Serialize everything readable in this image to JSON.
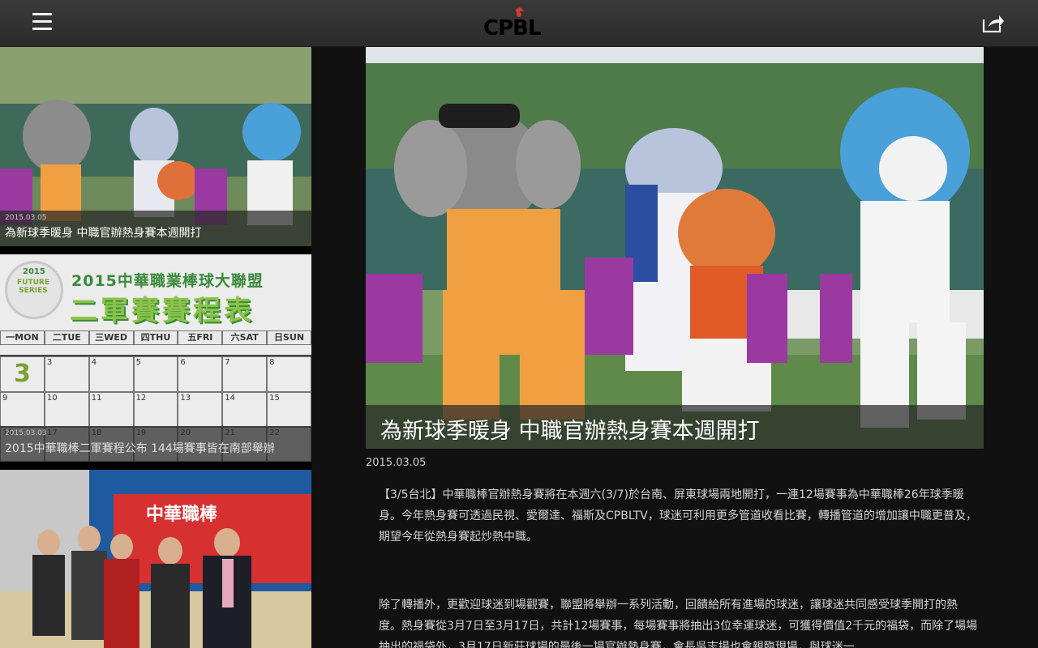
{
  "header": {
    "logo_text": "CPBL",
    "menu_icon": "hamburger-menu-icon",
    "share_icon": "share-icon"
  },
  "news_list": [
    {
      "date": "2015.03.05",
      "title": "為新球季暖身 中職官辦熱身賽本週開打"
    },
    {
      "date": "2015.03.03",
      "title": "2015中華職棒二軍賽程公布 144場賽事皆在南部舉辦",
      "schedule_image": {
        "year": "2015",
        "badge": "FUTURE SERIES",
        "heading_line1": "2015中華職業棒球大聯盟",
        "heading_line2": "二軍賽賽程表",
        "days": [
          "一MON",
          "二TUE",
          "三WED",
          "四THU",
          "五FRI",
          "六SAT",
          "日SUN"
        ],
        "dates": [
          "3",
          "3",
          "4",
          "5",
          "6",
          "7",
          "8",
          "9",
          "10",
          "11",
          "12",
          "13",
          "14",
          "15",
          "16",
          "17",
          "18",
          "19",
          "20",
          "21",
          "22"
        ]
      }
    },
    {
      "date": "",
      "title": "",
      "banner_text": "中華職棒"
    }
  ],
  "article": {
    "title": "為新球季暖身 中職官辦熱身賽本週開打",
    "date": "2015.03.05",
    "paragraph1": "【3/5台北】中華職棒官辦熱身賽將在本週六(3/7)於台南、屏東球場兩地開打，一連12場賽事為中華職棒26年球季暖身。今年熱身賽可透過民視、愛爾達、福斯及CPBLTV，球迷可利用更多管道收看比賽，轉播管道的增加讓中職更普及，期望今年從熱身賽起炒熱中職。",
    "paragraph2": "除了轉播外，更歡迎球迷到場觀賽，聯盟將舉辦一系列活動，回饋給所有進場的球迷，讓球迷共同感受球季開打的熱度。熱身賽從3月7日至3月17日，共計12場賽事，每場賽事將抽出3位幸運球迷，可獲得價值2千元的福袋，而除了場場抽出的福袋外，3月17日新莊球場的最後一場官辦熱身賽，會長吳志揚也會親臨現場，與球迷一"
  }
}
